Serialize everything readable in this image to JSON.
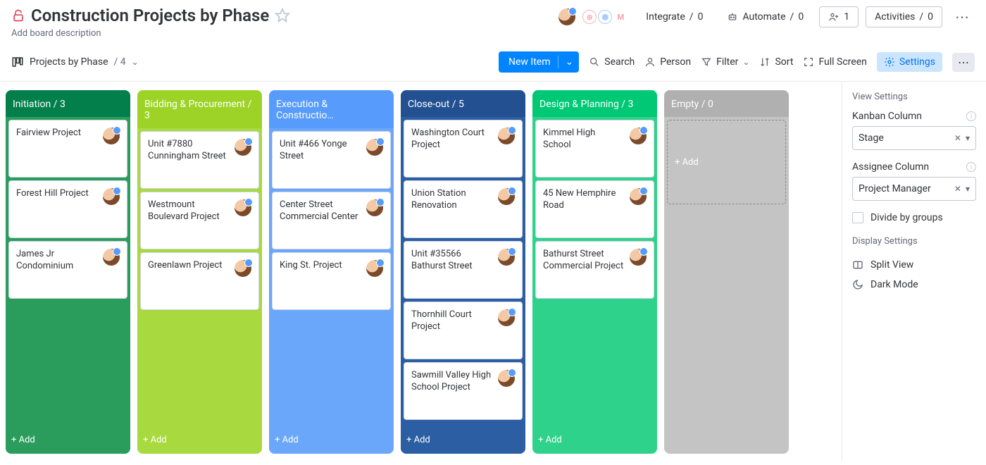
{
  "header": {
    "title": "Construction Projects by Phase",
    "description_placeholder": "Add board description",
    "integrate": {
      "label": "Integrate",
      "count": 0
    },
    "automate": {
      "label": "Automate",
      "count": 0
    },
    "invite_count": 1,
    "activities": {
      "label": "Activities",
      "count": 0
    }
  },
  "toolbar": {
    "view_name": "Projects by Phase",
    "view_count": 4,
    "new_item": "New Item",
    "controls": {
      "search": "Search",
      "person": "Person",
      "filter": "Filter",
      "sort": "Sort",
      "fullscreen": "Full Screen",
      "settings": "Settings"
    }
  },
  "columns": [
    {
      "name": "Initiation",
      "count": 3,
      "bg": "#037f4c",
      "body": "#2a9d5c",
      "cards": [
        "Fairview Project",
        "Forest Hill Project",
        "James Jr Condominium"
      ]
    },
    {
      "name": "Bidding & Procurement",
      "count": 3,
      "bg": "#9cd326",
      "body": "#a8d93e",
      "cards": [
        "Unit #7880 Cunningham Street",
        "Westmount Boulevard Project",
        "Greenlawn Project"
      ]
    },
    {
      "name": "Execution & Constructio…",
      "count": "",
      "bg": "#579bfc",
      "body": "#6aa7fb",
      "cards": [
        "Unit #466 Yonge Street",
        "Center Street Commercial Center",
        "King St. Project"
      ]
    },
    {
      "name": "Close-out",
      "count": 5,
      "bg": "#225091",
      "body": "#2b5ea3",
      "cards": [
        "Washington Court Project",
        "Union Station Renovation",
        "Unit #35566 Bathurst Street",
        "Thornhill Court Project",
        "Sawmill Valley High School Project"
      ]
    },
    {
      "name": "Design & Planning",
      "count": 3,
      "bg": "#00c875",
      "body": "#2fd28a",
      "cards": [
        "Kimmel High School",
        "45 New Hemphire Road",
        "Bathurst Street Commercial Project"
      ]
    },
    {
      "name": "Empty",
      "count": 0,
      "bg": "#b0b0b0",
      "body": "#c4c4c4",
      "cards": []
    }
  ],
  "add_label": "+ Add",
  "panel": {
    "view_settings": "View Settings",
    "kanban_label": "Kanban Column",
    "kanban_value": "Stage",
    "assignee_label": "Assignee Column",
    "assignee_value": "Project Manager",
    "divide": "Divide by groups",
    "display_settings": "Display Settings",
    "split_view": "Split View",
    "dark_mode": "Dark Mode"
  }
}
